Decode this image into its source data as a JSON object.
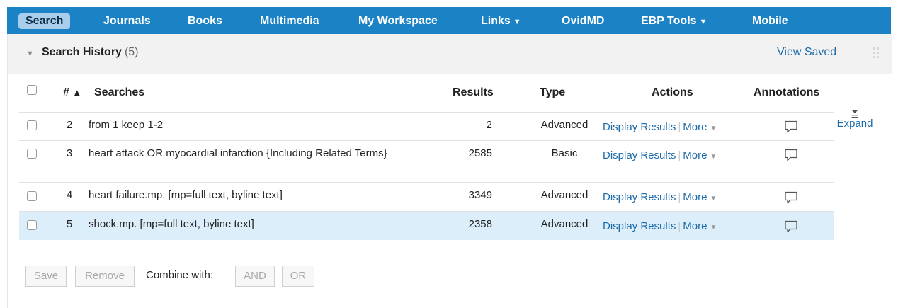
{
  "nav": {
    "items": [
      {
        "label": "Search"
      },
      {
        "label": "Journals"
      },
      {
        "label": "Books"
      },
      {
        "label": "Multimedia"
      },
      {
        "label": "My Workspace"
      },
      {
        "label": "Links",
        "caret": "▼"
      },
      {
        "label": "OvidMD"
      },
      {
        "label": "EBP Tools",
        "caret": "▼"
      },
      {
        "label": "Mobile"
      }
    ]
  },
  "history": {
    "collapse_glyph": "▼",
    "title": "Search History",
    "count": "(5)",
    "view_saved": "View Saved"
  },
  "table": {
    "headers": {
      "number": "#",
      "sort_glyph": "▲",
      "searches": "Searches",
      "results": "Results",
      "type": "Type",
      "actions": "Actions",
      "annotations": "Annotations"
    },
    "rows": [
      {
        "num": "2",
        "search": "from 1 keep 1-2",
        "results": "2",
        "type": "Advanced",
        "display": "Display Results",
        "more": "More",
        "selected": false
      },
      {
        "num": "3",
        "search": "heart attack OR myocardial infarction {Including Related Terms}",
        "results": "2585",
        "type": "Basic",
        "display": "Display Results",
        "more": "More",
        "selected": false
      },
      {
        "num": "4",
        "search": "heart failure.mp. [mp=full text, byline text]",
        "results": "3349",
        "type": "Advanced",
        "display": "Display Results",
        "more": "More",
        "selected": false
      },
      {
        "num": "5",
        "search": "shock.mp. [mp=full text, byline text]",
        "results": "2358",
        "type": "Advanced",
        "display": "Display Results",
        "more": "More",
        "selected": true
      }
    ],
    "more_caret": "▼",
    "annotation_icon": "comment-icon"
  },
  "expand": {
    "label": "Expand",
    "icon": "expand-icon"
  },
  "footer": {
    "save": "Save",
    "remove": "Remove",
    "combine_label": "Combine with:",
    "and": "AND",
    "or": "OR"
  },
  "colors": {
    "nav_bg": "#1b82c6",
    "nav_active_bg": "#a9cdea",
    "link": "#1c6aa8",
    "selected_row": "#dbeefa",
    "header_bg": "#f2f2f2"
  }
}
